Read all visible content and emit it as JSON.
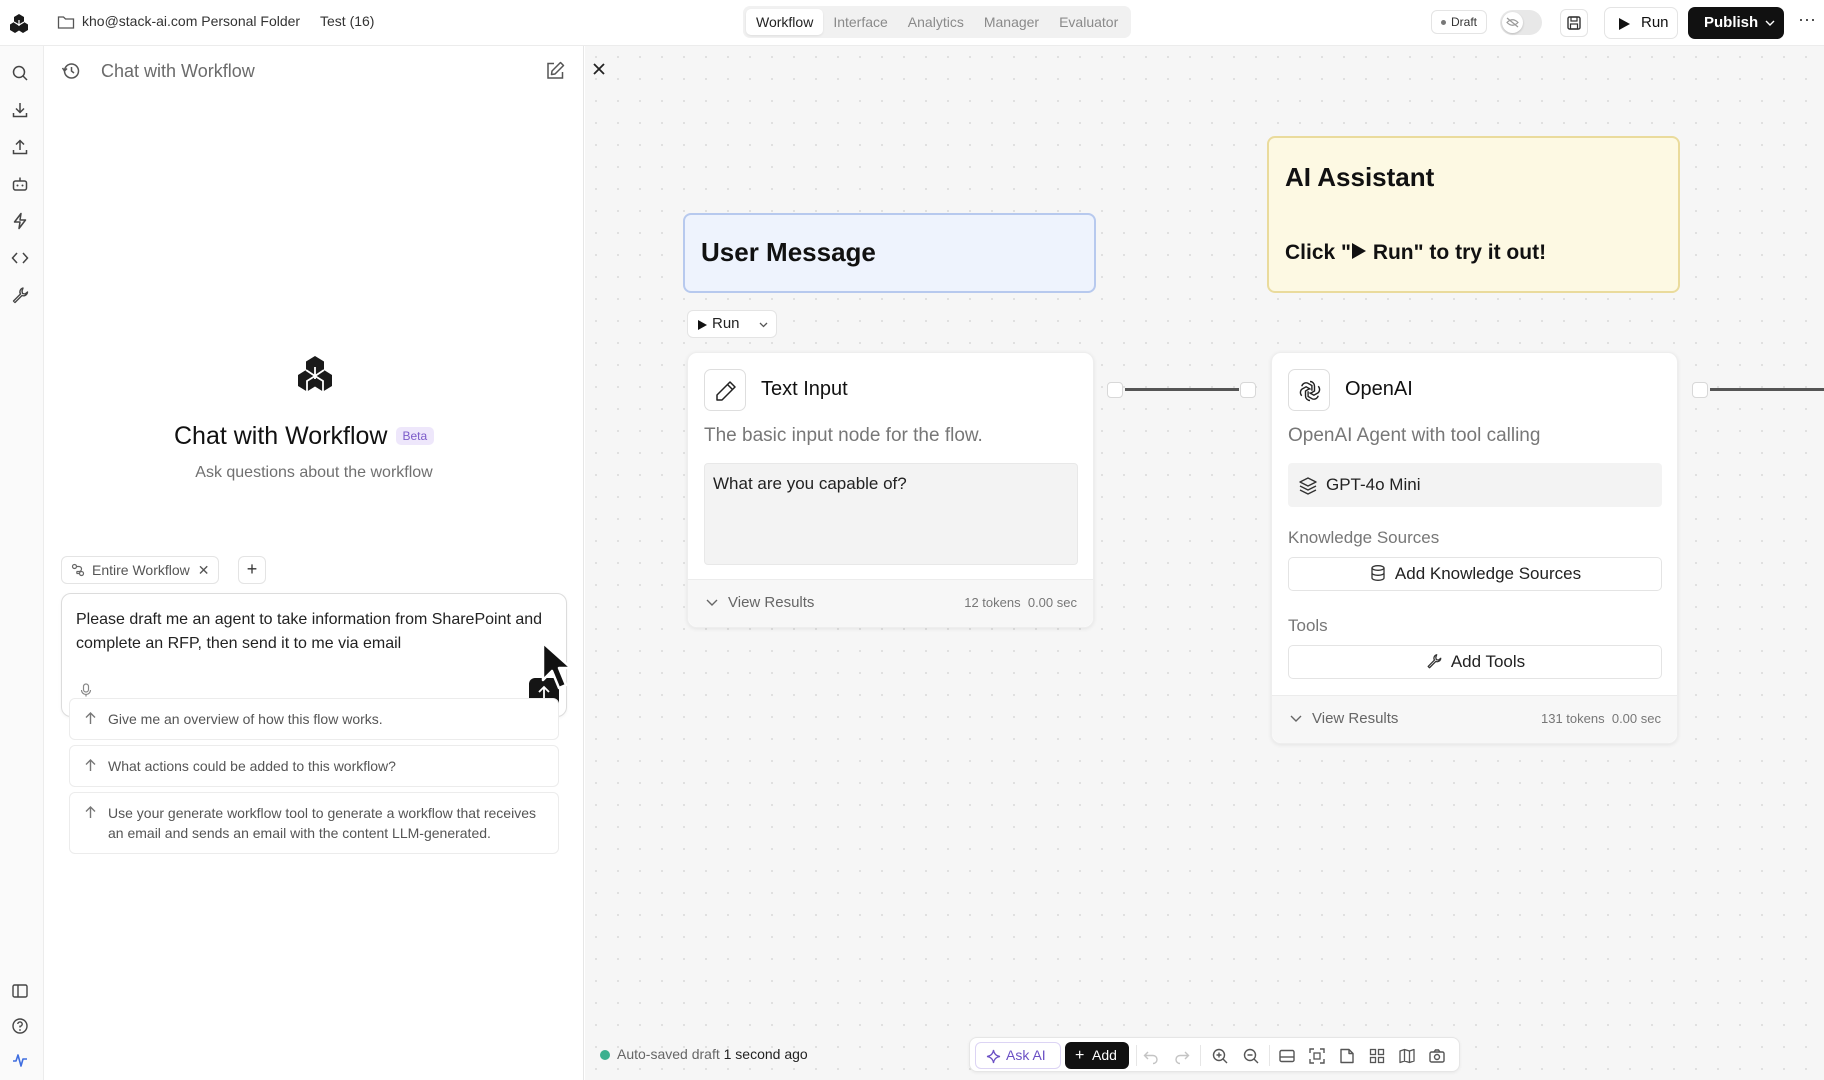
{
  "topbar": {
    "folder_label": "kho@stack-ai.com Personal Folder",
    "project_label": "Test (16)",
    "tabs": [
      {
        "label": "Workflow",
        "active": true
      },
      {
        "label": "Interface",
        "active": false
      },
      {
        "label": "Analytics",
        "active": false
      },
      {
        "label": "Manager",
        "active": false
      },
      {
        "label": "Evaluator",
        "active": false
      }
    ],
    "status_label": "Draft",
    "run_label": "Run",
    "publish_label": "Publish",
    "more_label": "···"
  },
  "left_rail": {
    "top_icons": [
      "search-icon",
      "download-icon",
      "upload-icon",
      "bot-icon",
      "lightning-icon",
      "code-icon",
      "wrench-icon"
    ],
    "bottom_icons": [
      "sidebar-toggle-icon",
      "help-icon",
      "activity-icon"
    ]
  },
  "chat_panel": {
    "title": "Chat with Workflow",
    "hero_title": "Chat with Workflow",
    "beta_label": "Beta",
    "hero_subtitle": "Ask questions about the workflow",
    "context_chip": "Entire Workflow",
    "add_context_label": "+",
    "composer_text": "Please draft me an agent to take information from SharePoint and complete an RFP, then send it to me via email",
    "suggestions": [
      "Give me an overview of how this flow works.",
      "What actions could be added to this workflow?",
      "Use your generate workflow tool to generate a workflow that receives an email and sends an email with the content LLM-generated."
    ]
  },
  "canvas": {
    "notes": {
      "user_message": {
        "title": "User Message"
      },
      "ai_assistant": {
        "title": "AI Assistant",
        "body_prefix": "Click \"",
        "body_run": " Run",
        "body_suffix": "\" to try it out!"
      }
    },
    "mini_run_label": "Run",
    "text_input_node": {
      "title": "Text Input",
      "description": "The basic input node for the flow.",
      "input_value": "What are you capable of?",
      "view_results": "View Results",
      "tokens": "12 tokens",
      "time": "0.00 sec"
    },
    "openai_node": {
      "title": "OpenAI",
      "description": "OpenAI Agent with tool calling",
      "model": "GPT-4o Mini",
      "knowledge_label": "Knowledge Sources",
      "add_knowledge": "Add Knowledge Sources",
      "tools_label": "Tools",
      "add_tools": "Add Tools",
      "view_results": "View Results",
      "tokens": "131 tokens",
      "time": "0.00 sec"
    }
  },
  "status_bar": {
    "autosave_text": "Auto-saved draft",
    "autosave_time": "1 second ago"
  },
  "bottom_toolbar": {
    "ask_ai_label": "Ask AI",
    "add_label": "Add",
    "icons": [
      "undo-icon",
      "redo-icon",
      "zoom-in-icon",
      "zoom-out-icon",
      "layout-icon",
      "fit-view-icon",
      "note-icon",
      "grid-icon",
      "map-icon",
      "screenshot-icon"
    ]
  },
  "colors": {
    "accent_purple": "#7c5bc9",
    "autosave_green": "#3bb08f",
    "user_note_bg": "#eef3fd",
    "ai_note_bg": "#fdf9e3"
  }
}
